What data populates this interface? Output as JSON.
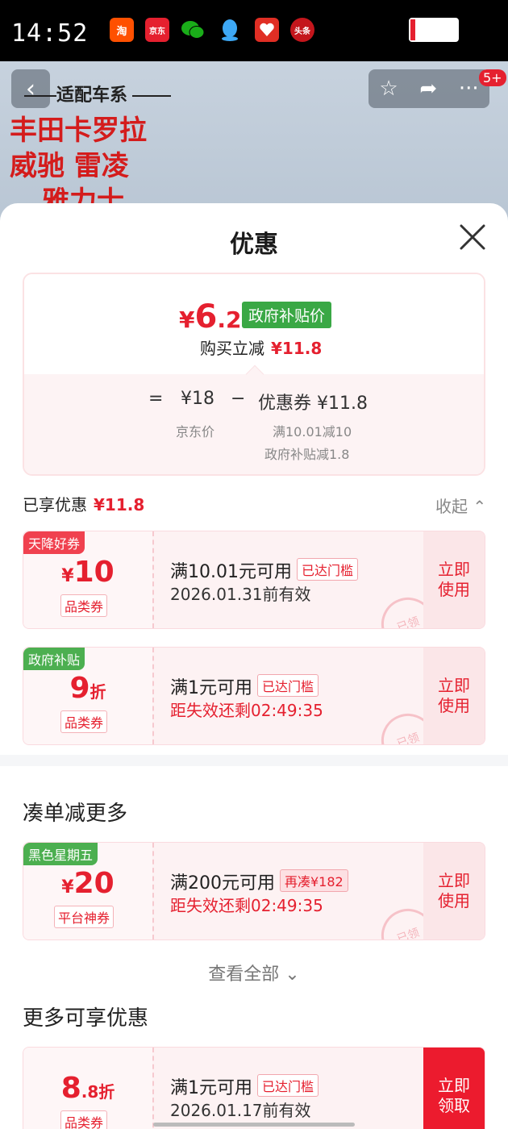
{
  "status_bar": {
    "time": "14:52",
    "apps": [
      {
        "name": "taobao-icon",
        "label": "淘",
        "color": "#ff5000"
      },
      {
        "name": "jd-icon",
        "label": "京东",
        "color": "#e5202f"
      },
      {
        "name": "wechat-icon",
        "label": "",
        "color": "#1aad19"
      },
      {
        "name": "qq-icon",
        "label": "",
        "color": "#1da1f2"
      },
      {
        "name": "pinduoduo-icon",
        "label": "",
        "color": "#e02e24"
      },
      {
        "name": "toutiao-icon",
        "label": "头条",
        "color": "#c4161c"
      }
    ]
  },
  "product": {
    "fit_series": "适配车系",
    "lines": [
      "丰田卡罗拉",
      "威驰 雷凌",
      "雅力士"
    ],
    "badge_count": "5+"
  },
  "sheet": {
    "title": "优惠",
    "price_card": {
      "currency": "¥",
      "price_int": "6",
      "price_dec": ".2",
      "price_tag": "政府补贴价",
      "buy_reduce_label": "购买立减",
      "buy_reduce_value": "¥11.8",
      "eq_sign": "=",
      "base_price": "¥18",
      "minus_sign": "−",
      "coupon_expr": "优惠券 ¥11.8",
      "base_label": "京东价",
      "detail_1": "满10.01减10",
      "detail_2": "政府补贴减1.8"
    },
    "enjoyed_label": "已享优惠",
    "enjoyed_value": "¥11.8",
    "collapse_label": "收起"
  },
  "coupons": [
    {
      "tag": "天降好券",
      "sym": "¥",
      "num": "10",
      "unit": "",
      "kind": "品类券",
      "condition": "满10.01元可用",
      "pill": "已达门槛",
      "date": "2026.01.31前有效",
      "action": "立即使用",
      "stamp": "已领"
    },
    {
      "tag": "政府补贴",
      "sym": "",
      "num": "9",
      "unit": "折",
      "kind": "品类券",
      "condition": "满1元可用",
      "pill": "已达门槛",
      "date": "距失效还剩02:49:35",
      "action": "立即使用",
      "stamp": "已领"
    }
  ],
  "more_section": {
    "title": "凑单减更多",
    "coupon": {
      "tag": "黑色星期五",
      "sym": "¥",
      "num": "20",
      "unit": "",
      "kind": "平台神券",
      "condition": "满200元可用",
      "pill": "再凑¥182",
      "date": "距失效还剩02:49:35",
      "action": "立即使用",
      "stamp": "已领"
    },
    "view_all": "查看全部"
  },
  "extra_section": {
    "title": "更多可享优惠",
    "coupon": {
      "tag": "",
      "sym": "",
      "num": "8",
      "unit": ".8折",
      "kind": "品类券",
      "condition": "满1元可用",
      "pill": "已达门槛",
      "date": "2026.01.17前有效",
      "action": "立即领取"
    }
  }
}
